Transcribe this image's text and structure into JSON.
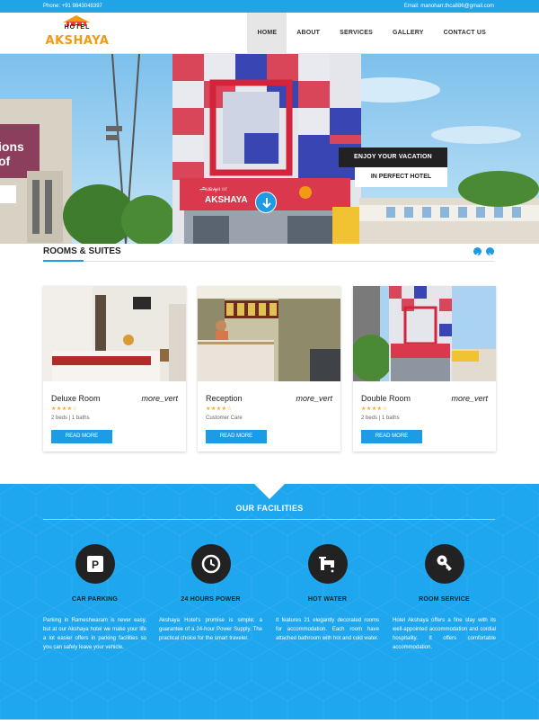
{
  "topbar": {
    "phone": "Phone: +91 9843048397",
    "email": "Email: manoharr.thca886@gmail.com"
  },
  "logo": {
    "small": "HOTEL",
    "brand": "AKSHAYA"
  },
  "nav": {
    "items": [
      "HOME",
      "ABOUT",
      "SERVICES",
      "GALLERY",
      "CONTACT US"
    ],
    "active": "HOME"
  },
  "hero": {
    "caption_line1": "ENJOY YOUR VACATION",
    "caption_line2": "IN PERFECT HOTEL",
    "scroll_icon": "arrow-down-icon"
  },
  "rooms": {
    "title": "ROOMS & SUITES",
    "prev_icon": "chevron-left-icon",
    "next_icon": "chevron-right-icon",
    "cards": [
      {
        "title": "Deluxe Room",
        "more": "more_vert",
        "rating": 4,
        "meta": "2 beds | 1 baths",
        "button": "READ MORE"
      },
      {
        "title": "Reception",
        "more": "more_vert",
        "rating": 4,
        "meta": "Customer Care",
        "button": "READ MORE"
      },
      {
        "title": "Double Room",
        "more": "more_vert",
        "rating": 4,
        "meta": "2 beds | 1 baths",
        "button": "READ MORE"
      }
    ]
  },
  "facilities": {
    "title": "OUR FACILITIES",
    "items": [
      {
        "icon": "parking-icon",
        "title": "CAR PARKING",
        "text": "Parking in Rameshwaram is never easy, but at our Akshaya hotel we make your life a lot easier offers in parking facilities so you can safely leave your vehicle."
      },
      {
        "icon": "clock-icon",
        "title": "24 HOURS POWER",
        "text": "Akshaya Hotel's promise is simple; a guarantee of a 24-hour Power Supply. The practical choice for the smart traveler."
      },
      {
        "icon": "faucet-icon",
        "title": "HOT WATER",
        "text": "It features 21 elegantly decorated rooms for accommodation. Each room have attached bathroom with hot and cold water."
      },
      {
        "icon": "key-icon",
        "title": "ROOM SERVICE",
        "text": "Hotel Akshaya offers a fine stay with its well-appointed accommodation and cordial hospitality. It offers comfortable accommodation."
      }
    ]
  },
  "colors": {
    "accent": "#1d9be5",
    "facilities_bg": "#1ea6ee",
    "brand_orange": "#f29a14",
    "dark": "#222222"
  }
}
